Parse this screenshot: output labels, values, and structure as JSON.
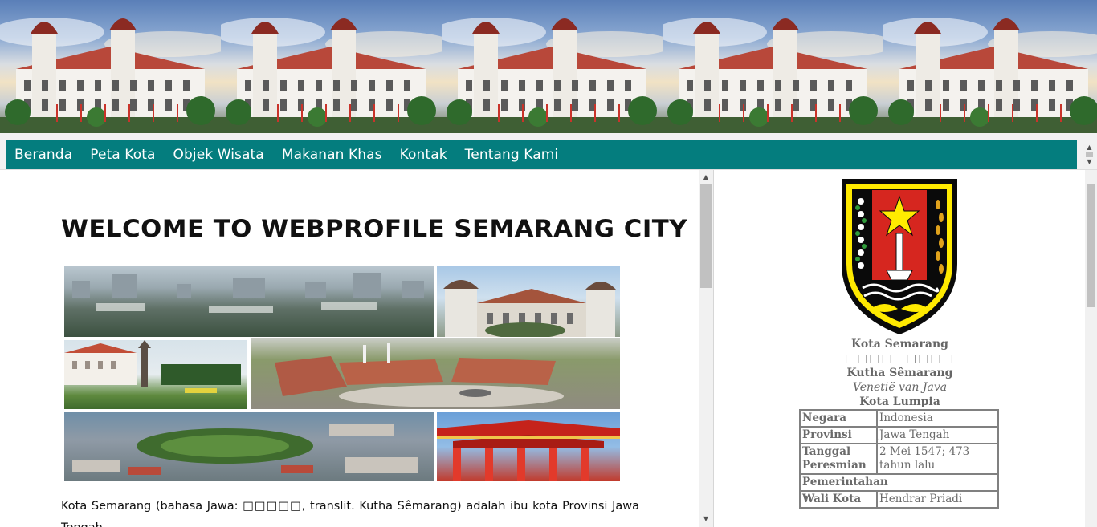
{
  "nav": {
    "items": [
      "Beranda",
      "Peta Kota",
      "Objek Wisata",
      "Makanan Khas",
      "Kontak",
      "Tentang Kami"
    ]
  },
  "main": {
    "heading": "WELCOME TO WEBPROFILE SEMARANG CITY",
    "intro_text": "Kota Semarang (bahasa Jawa: □□□□□, translit. Kutha Sêmarang) adalah ibu kota Provinsi Jawa Tengah,"
  },
  "sidebar": {
    "names": {
      "kota": "Kota Semarang",
      "javanese_script": "□□□□□□□□□",
      "kutha": "Kutha Sêmarang",
      "nickname_venetie": "Venetië van Java",
      "nickname_lumpia": "Kota Lumpia"
    },
    "table": {
      "negara_key": "Negara",
      "negara_val": "Indonesia",
      "provinsi_key": "Provinsi",
      "provinsi_val": "Jawa Tengah",
      "tanggal_key": "Tanggal Peresmian",
      "tanggal_val": "2 Mei 1547; 473 tahun lalu",
      "pemerintahan": "Pemerintahan",
      "walikota_key": "Wali Kota",
      "walikota_val": "Hendrar Priadi"
    }
  },
  "colors": {
    "nav_bg": "#047d7e",
    "nav_text": "#ffffff",
    "crest_yellow": "#ffea00",
    "crest_red": "#d6261f"
  }
}
